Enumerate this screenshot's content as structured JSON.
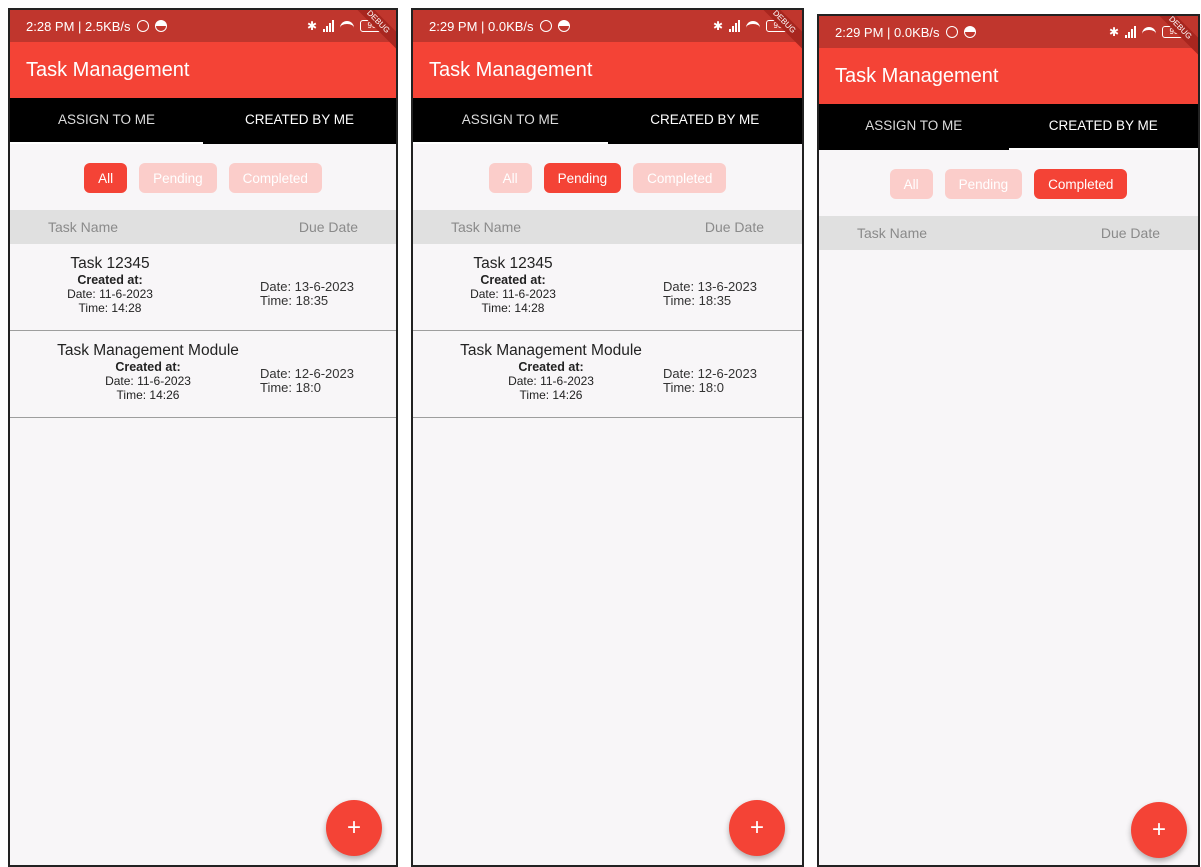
{
  "screens": [
    {
      "status_time": "2:28 PM | 2.5KB/s",
      "app_title": "Task Management",
      "tabs": [
        "ASSIGN TO ME",
        "CREATED BY ME"
      ],
      "filters": [
        {
          "label": "All",
          "active": true
        },
        {
          "label": "Pending",
          "active": false
        },
        {
          "label": "Completed",
          "active": false
        }
      ],
      "table_headers": {
        "task_name": "Task Name",
        "due_date": "Due Date"
      },
      "rows": [
        {
          "name": "Task 12345",
          "created_label": "Created at:",
          "created_date": "Date: 11-6-2023",
          "created_time": "Time: 14:28",
          "due_date": "Date: 13-6-2023",
          "due_time": "Time: 18:35"
        },
        {
          "name": "Task Management Module",
          "created_label": "Created at:",
          "created_date": "Date: 11-6-2023",
          "created_time": "Time: 14:26",
          "due_date": "Date: 12-6-2023",
          "due_time": "Time: 18:0"
        }
      ],
      "fab_label": "+"
    },
    {
      "status_time": "2:29 PM | 0.0KB/s",
      "app_title": "Task Management",
      "tabs": [
        "ASSIGN TO ME",
        "CREATED BY ME"
      ],
      "filters": [
        {
          "label": "All",
          "active": false
        },
        {
          "label": "Pending",
          "active": true
        },
        {
          "label": "Completed",
          "active": false
        }
      ],
      "table_headers": {
        "task_name": "Task Name",
        "due_date": "Due Date"
      },
      "rows": [
        {
          "name": "Task 12345",
          "created_label": "Created at:",
          "created_date": "Date: 11-6-2023",
          "created_time": "Time: 14:28",
          "due_date": "Date: 13-6-2023",
          "due_time": "Time: 18:35"
        },
        {
          "name": "Task Management Module",
          "created_label": "Created at:",
          "created_date": "Date: 11-6-2023",
          "created_time": "Time: 14:26",
          "due_date": "Date: 12-6-2023",
          "due_time": "Time: 18:0"
        }
      ],
      "fab_label": "+"
    },
    {
      "status_time": "2:29 PM | 0.0KB/s",
      "app_title": "Task Management",
      "tabs": [
        "ASSIGN TO ME",
        "CREATED BY ME"
      ],
      "filters": [
        {
          "label": "All",
          "active": false
        },
        {
          "label": "Pending",
          "active": false
        },
        {
          "label": "Completed",
          "active": true
        }
      ],
      "table_headers": {
        "task_name": "Task Name",
        "due_date": "Due Date"
      },
      "rows": [],
      "fab_label": "+"
    }
  ],
  "colors": {
    "accent": "#f44336",
    "status_bar": "#c0362d",
    "chip_inactive": "#fbcdca",
    "tab_bar": "#000000"
  },
  "debug_banner": "DEBUG",
  "battery_level": "93"
}
